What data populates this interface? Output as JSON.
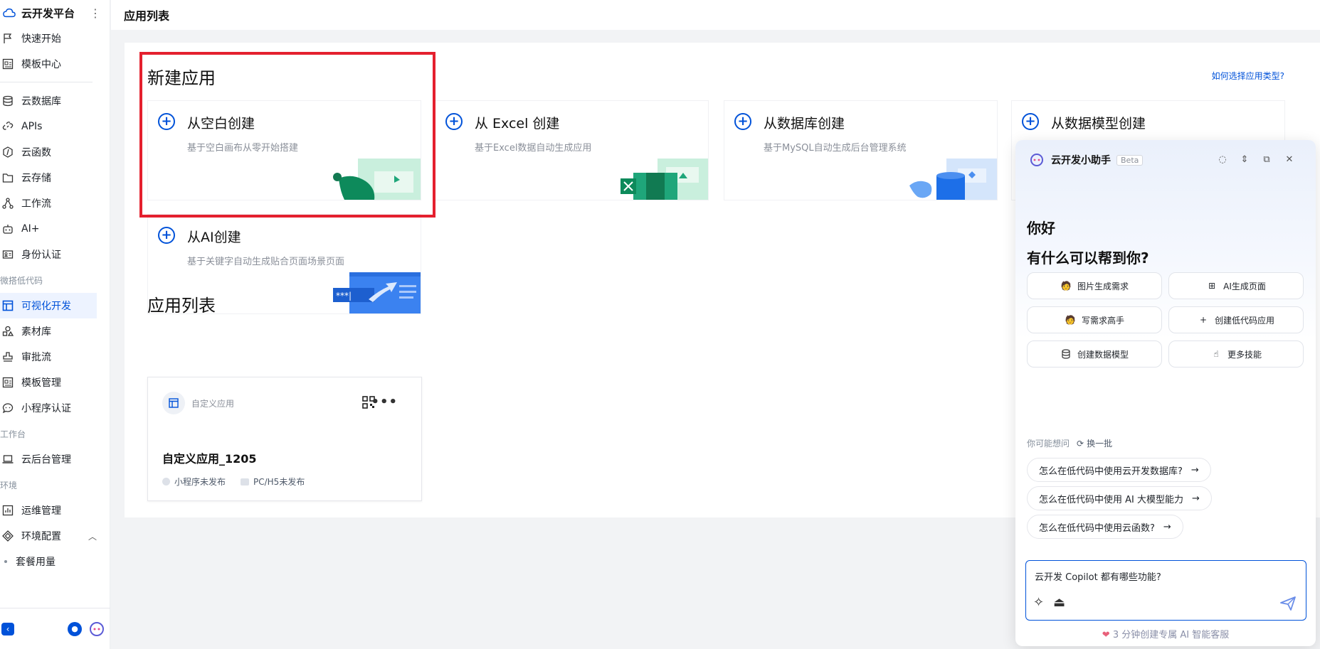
{
  "sidebar": {
    "brand": "云开发平台",
    "items": [
      {
        "label": "快速开始",
        "icon": "flag-icon"
      },
      {
        "label": "模板中心",
        "icon": "template-icon"
      },
      {
        "label": "云数据库",
        "icon": "database-icon"
      },
      {
        "label": "APIs",
        "icon": "link-icon"
      },
      {
        "label": "云函数",
        "icon": "function-icon"
      },
      {
        "label": "云存储",
        "icon": "storage-icon"
      },
      {
        "label": "工作流",
        "icon": "workflow-icon"
      },
      {
        "label": "AI+",
        "icon": "robot-icon"
      },
      {
        "label": "身份认证",
        "icon": "id-card-icon"
      }
    ],
    "group_lowcode": "微搭低代码",
    "lowcode_items": [
      {
        "label": "可视化开发",
        "icon": "layout-icon",
        "active": true
      },
      {
        "label": "素材库",
        "icon": "shapes-icon"
      },
      {
        "label": "审批流",
        "icon": "stamp-icon"
      },
      {
        "label": "模板管理",
        "icon": "template-manage-icon"
      },
      {
        "label": "小程序认证",
        "icon": "chat-icon"
      }
    ],
    "group_workbench": "工作台",
    "workbench_items": [
      {
        "label": "云后台管理",
        "icon": "laptop-icon"
      }
    ],
    "group_env": "环境",
    "env_items": [
      {
        "label": "运维管理",
        "icon": "chart-icon"
      },
      {
        "label": "环境配置",
        "icon": "cube-icon"
      }
    ],
    "env_sub": "套餐用量"
  },
  "header": {
    "title": "应用列表"
  },
  "main": {
    "new_app_title": "新建应用",
    "help_link": "如何选择应用类型?",
    "create_cards": [
      {
        "title": "从空白创建",
        "desc": "基于空白画布从零开始搭建"
      },
      {
        "title": "从 Excel 创建",
        "desc": "基于Excel数据自动生成应用"
      },
      {
        "title": "从数据库创建",
        "desc": "基于MySQL自动生成后台管理系统"
      },
      {
        "title": "从数据模型创建",
        "desc": ""
      },
      {
        "title": "从AI创建",
        "desc": "基于关键字自动生成贴合页面场景页面"
      }
    ],
    "app_list_title": "应用列表",
    "app_card": {
      "type": "自定义应用",
      "name": "自定义应用_1205",
      "status_mini": "小程序未发布",
      "status_web": "PC/H5未发布"
    }
  },
  "assistant": {
    "name": "云开发小助手",
    "badge": "Beta",
    "greeting": "你好",
    "question": "有什么可以帮到你?",
    "chips": [
      {
        "label": "图片生成需求",
        "icon": "avatar-icon"
      },
      {
        "label": "AI生成页面",
        "icon": "grid-icon"
      },
      {
        "label": "写需求高手",
        "icon": "avatar-icon"
      },
      {
        "label": "创建低代码应用",
        "icon": "plus-icon"
      },
      {
        "label": "创建数据模型",
        "icon": "database-icon"
      },
      {
        "label": "更多技能",
        "icon": "pointer-icon"
      }
    ],
    "maybe_label": "你可能想问",
    "refresh_label": "换一批",
    "suggestions": [
      "怎么在低代码中使用云开发数据库?",
      "怎么在低代码中使用 AI 大模型能力",
      "怎么在低代码中使用云函数?"
    ],
    "input_value": "云开发 Copilot 都有哪些功能?",
    "promo": "3 分钟创建专属 AI 智能客服"
  }
}
